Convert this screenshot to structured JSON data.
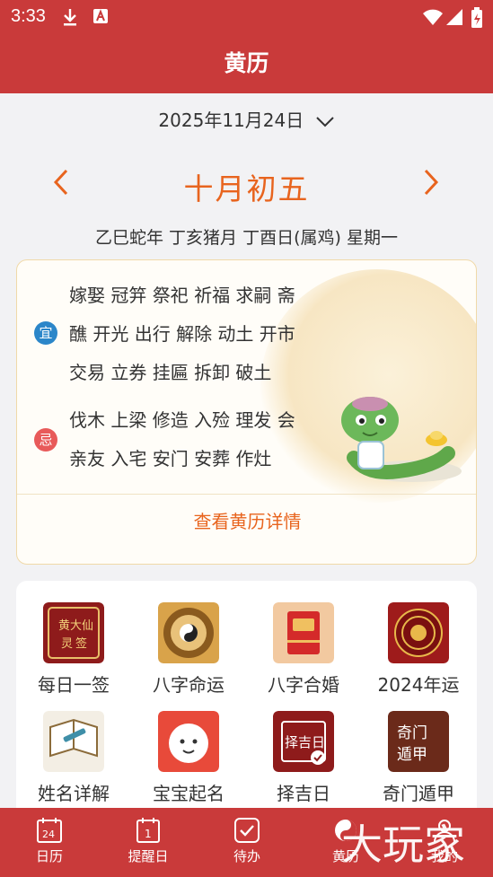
{
  "status_bar": {
    "time": "3:33"
  },
  "header": {
    "title": "黄历"
  },
  "date_picker": {
    "date": "2025年11月24日"
  },
  "lunar": {
    "date": "十月初五",
    "ganzhi": "乙巳蛇年 丁亥猪月 丁酉日(属鸡) 星期一"
  },
  "almanac": {
    "yi_tag": "宜",
    "yi_lines": [
      "嫁娶 冠笄 祭祀 祈福 求嗣 斋",
      "醮 开光 出行 解除 动土 开市",
      "交易 立券 挂匾 拆卸 破土"
    ],
    "ji_tag": "忌",
    "ji_lines": [
      "伐木 上梁 修造 入殓 理发 会",
      "亲友 入宅 安门 安葬 作灶"
    ],
    "detail_link": "查看黄历详情"
  },
  "tools": [
    {
      "label": "每日一签",
      "icon": "lottery-sign-icon"
    },
    {
      "label": "八字命运",
      "icon": "bagua-compass-icon"
    },
    {
      "label": "八字合婚",
      "icon": "red-envelope-icon"
    },
    {
      "label": "2024年运",
      "icon": "fortune-wheel-icon"
    },
    {
      "label": "姓名详解",
      "icon": "book-scroll-icon"
    },
    {
      "label": "宝宝起名",
      "icon": "baby-face-icon"
    },
    {
      "label": "择吉日",
      "icon": "calendar-pick-icon"
    },
    {
      "label": "奇门遁甲",
      "icon": "qimen-icon"
    }
  ],
  "icon_texts": {
    "lottery": [
      "黄",
      "大",
      "仙",
      "灵",
      "签"
    ],
    "calendar": "择吉日",
    "qimen": [
      "奇门",
      "遁甲"
    ]
  },
  "tabbar": {
    "items": [
      {
        "label": "日历",
        "icon": "calendar-24-icon",
        "badge": "24"
      },
      {
        "label": "提醒日",
        "icon": "reminder-icon",
        "badge": "1"
      },
      {
        "label": "待办",
        "icon": "todo-check-icon"
      },
      {
        "label": "黄历",
        "icon": "almanac-icon",
        "active": true
      },
      {
        "label": "我的",
        "icon": "profile-icon"
      }
    ]
  },
  "watermark": "大玩家",
  "colors": {
    "primary": "#c93a3a",
    "accent": "#e8641e",
    "yi": "#2b86c9",
    "ji": "#e85a5a"
  }
}
